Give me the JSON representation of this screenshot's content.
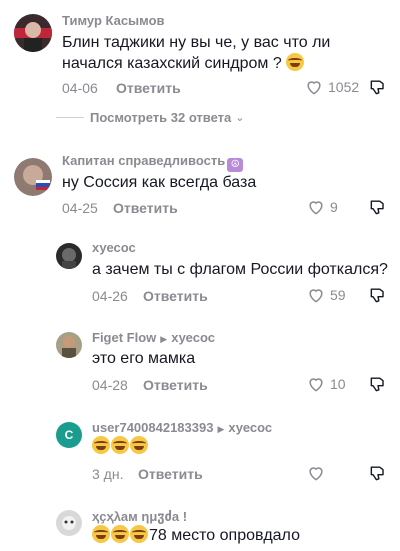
{
  "actions": {
    "reply_label": "Ответить",
    "view_replies_label": "Посмотреть 32 ответа"
  },
  "colors": {
    "meta_gray": "#8a8b91",
    "text_dark": "#161823",
    "divider": "#d0d1d3"
  },
  "comments": [
    {
      "username": "Тимур Касымов",
      "text": "Блин таджики ну вы че, у вас что ли начался казахский синдром ?",
      "emoji": "crying-face",
      "date": "04-06",
      "likes": "1052"
    },
    {
      "username": "Капитан справедливость",
      "badge": "☮",
      "text": "ну Соссия как всегда база",
      "date": "04-25",
      "likes": "9"
    }
  ],
  "replies": [
    {
      "username": "хуесос",
      "text": "а зачем ты с флагом России фоткался?",
      "date": "04-26",
      "likes": "59"
    },
    {
      "username": "Figet Flow",
      "reply_to": "хуесос",
      "text": "это его мамка",
      "date": "04-28",
      "likes": "10"
    },
    {
      "username": "user7400842183393",
      "reply_to": "хуесос",
      "avatar_letter": "C",
      "emoji_text": "😂😂😂",
      "date": "3 дн.",
      "likes": ""
    },
    {
      "username": "ҳҫҳλам ημჳძа !",
      "text": "78 место опровдало",
      "emoji_text": "😂😂😂"
    }
  ]
}
